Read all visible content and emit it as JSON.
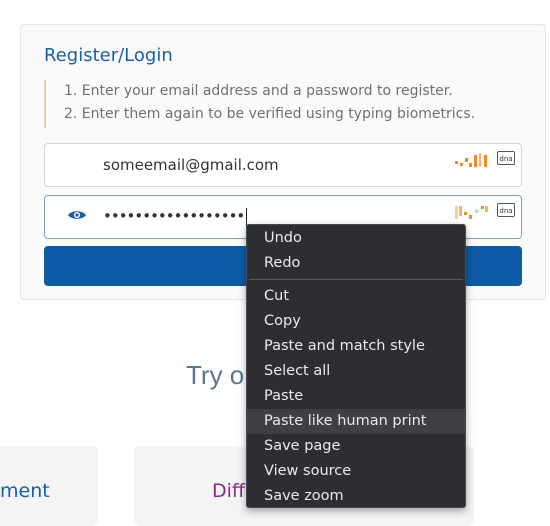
{
  "login_card": {
    "title": "Register/Login",
    "instructions": [
      "1. Enter your email address and a password to register.",
      "2. Enter them again to be verified using typing biometrics."
    ],
    "email_value": "someemail@gmail.com",
    "password_value": "••••••••••••••••••",
    "dna_badge": "dna",
    "typing_icon": "typing-pattern-icon",
    "eye_icon": "eye-icon"
  },
  "page": {
    "try_text": "Try o",
    "bottom_left_text": "ment",
    "bottom_right_text": "Diff"
  },
  "context_menu": {
    "group1": [
      "Undo",
      "Redo"
    ],
    "group2": [
      "Cut",
      "Copy",
      "Paste and match style",
      "Select all",
      "Paste",
      "Paste like human print",
      "Save page",
      "View source",
      "Save zoom"
    ],
    "highlighted": "Paste like human print"
  },
  "colors": {
    "accent": "#0e5aa6",
    "title": "#1a5fa8",
    "menu_bg": "#2d2e31",
    "typing_orange": "#f08a24"
  }
}
